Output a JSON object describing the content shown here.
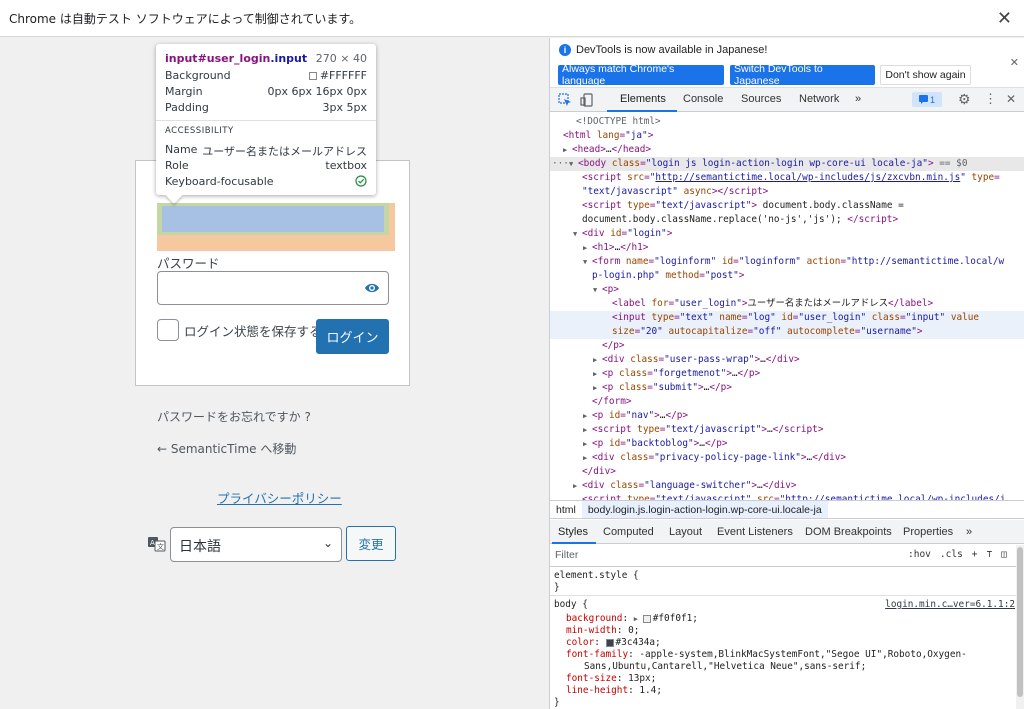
{
  "automation_bar": {
    "message": "Chrome は自動テスト ソフトウェアによって制御されています。",
    "close": "✕"
  },
  "tooltip": {
    "selector_tag": "input",
    "selector_id": "#user_login",
    "selector_class": ".input",
    "size": "270 × 40",
    "background_label": "Background",
    "background_value": "#FFFFFF",
    "margin_label": "Margin",
    "margin_value": "0px 6px 16px 0px",
    "padding_label": "Padding",
    "padding_value": "3px 5px",
    "section_title": "ACCESSIBILITY",
    "name_label": "Name",
    "name_value": "ユーザー名またはメールアドレス",
    "role_label": "Role",
    "role_value": "textbox",
    "focusable_label": "Keyboard-focusable"
  },
  "login": {
    "password_label": "パスワード",
    "remember_label": "ログイン状態を保存する",
    "login_button": "ログイン",
    "lost_password": "パスワードをお忘れですか ?",
    "back_link": "← SemanticTime へ移動",
    "privacy_link": "プライバシーポリシー",
    "language_value": "日本語",
    "change_button": "変更"
  },
  "devtools": {
    "banner_text": "DevTools is now available in Japanese!",
    "btn_match": "Always match Chrome's language",
    "btn_switch": "Switch DevTools to Japanese",
    "btn_dont_show": "Don't show again",
    "tabs": [
      "Elements",
      "Console",
      "Sources",
      "Network"
    ],
    "more": "»",
    "issues_count": "1",
    "crumbs": [
      "html",
      "body.login.js.login-action-login.wp-core-ui.locale-ja"
    ],
    "subtabs": [
      "Styles",
      "Computed",
      "Layout",
      "Event Listeners",
      "DOM Breakpoints",
      "Properties"
    ],
    "filter_placeholder": "Filter",
    "filter_hov": ":hov",
    "filter_cls": ".cls",
    "plus": "+",
    "element_style": "element.style {",
    "body_selector": "body {",
    "source_ref": "login.min.c…ver=6.1.1:2",
    "close_brace": "}",
    "styles": [
      {
        "prop": "background",
        "value": "#f0f0f1;",
        "color": "#f0f0f1"
      },
      {
        "prop": "min-width",
        "value": "0;"
      },
      {
        "prop": "color",
        "value": "#3c434a;",
        "color": "#3c434a"
      },
      {
        "prop": "font-family",
        "value": "-apple-system,BlinkMacSystemFont,\"Segoe UI\",Roboto,Oxygen-"
      },
      {
        "prop": "",
        "value": "Sans,Ubuntu,Cantarell,\"Helvetica Neue\",sans-serif;"
      },
      {
        "prop": "font-size",
        "value": "13px;"
      },
      {
        "prop": "line-height",
        "value": "1.4;"
      }
    ]
  },
  "colors": {
    "accent": "#2271b1",
    "devtools_blue": "#1a73e8",
    "tag": "#881280",
    "attr": "#994500",
    "value": "#1a1aa6"
  }
}
